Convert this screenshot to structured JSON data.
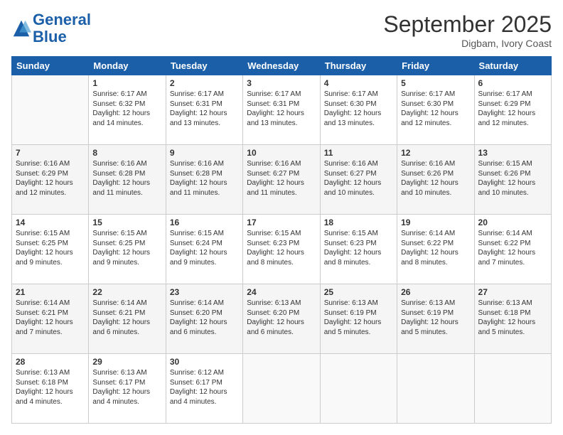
{
  "header": {
    "logo_line1": "General",
    "logo_line2": "Blue",
    "month": "September 2025",
    "location": "Digbam, Ivory Coast"
  },
  "weekdays": [
    "Sunday",
    "Monday",
    "Tuesday",
    "Wednesday",
    "Thursday",
    "Friday",
    "Saturday"
  ],
  "weeks": [
    [
      {
        "day": "",
        "info": ""
      },
      {
        "day": "1",
        "info": "Sunrise: 6:17 AM\nSunset: 6:32 PM\nDaylight: 12 hours\nand 14 minutes."
      },
      {
        "day": "2",
        "info": "Sunrise: 6:17 AM\nSunset: 6:31 PM\nDaylight: 12 hours\nand 13 minutes."
      },
      {
        "day": "3",
        "info": "Sunrise: 6:17 AM\nSunset: 6:31 PM\nDaylight: 12 hours\nand 13 minutes."
      },
      {
        "day": "4",
        "info": "Sunrise: 6:17 AM\nSunset: 6:30 PM\nDaylight: 12 hours\nand 13 minutes."
      },
      {
        "day": "5",
        "info": "Sunrise: 6:17 AM\nSunset: 6:30 PM\nDaylight: 12 hours\nand 12 minutes."
      },
      {
        "day": "6",
        "info": "Sunrise: 6:17 AM\nSunset: 6:29 PM\nDaylight: 12 hours\nand 12 minutes."
      }
    ],
    [
      {
        "day": "7",
        "info": "Sunrise: 6:16 AM\nSunset: 6:29 PM\nDaylight: 12 hours\nand 12 minutes."
      },
      {
        "day": "8",
        "info": "Sunrise: 6:16 AM\nSunset: 6:28 PM\nDaylight: 12 hours\nand 11 minutes."
      },
      {
        "day": "9",
        "info": "Sunrise: 6:16 AM\nSunset: 6:28 PM\nDaylight: 12 hours\nand 11 minutes."
      },
      {
        "day": "10",
        "info": "Sunrise: 6:16 AM\nSunset: 6:27 PM\nDaylight: 12 hours\nand 11 minutes."
      },
      {
        "day": "11",
        "info": "Sunrise: 6:16 AM\nSunset: 6:27 PM\nDaylight: 12 hours\nand 10 minutes."
      },
      {
        "day": "12",
        "info": "Sunrise: 6:16 AM\nSunset: 6:26 PM\nDaylight: 12 hours\nand 10 minutes."
      },
      {
        "day": "13",
        "info": "Sunrise: 6:15 AM\nSunset: 6:26 PM\nDaylight: 12 hours\nand 10 minutes."
      }
    ],
    [
      {
        "day": "14",
        "info": "Sunrise: 6:15 AM\nSunset: 6:25 PM\nDaylight: 12 hours\nand 9 minutes."
      },
      {
        "day": "15",
        "info": "Sunrise: 6:15 AM\nSunset: 6:25 PM\nDaylight: 12 hours\nand 9 minutes."
      },
      {
        "day": "16",
        "info": "Sunrise: 6:15 AM\nSunset: 6:24 PM\nDaylight: 12 hours\nand 9 minutes."
      },
      {
        "day": "17",
        "info": "Sunrise: 6:15 AM\nSunset: 6:23 PM\nDaylight: 12 hours\nand 8 minutes."
      },
      {
        "day": "18",
        "info": "Sunrise: 6:15 AM\nSunset: 6:23 PM\nDaylight: 12 hours\nand 8 minutes."
      },
      {
        "day": "19",
        "info": "Sunrise: 6:14 AM\nSunset: 6:22 PM\nDaylight: 12 hours\nand 8 minutes."
      },
      {
        "day": "20",
        "info": "Sunrise: 6:14 AM\nSunset: 6:22 PM\nDaylight: 12 hours\nand 7 minutes."
      }
    ],
    [
      {
        "day": "21",
        "info": "Sunrise: 6:14 AM\nSunset: 6:21 PM\nDaylight: 12 hours\nand 7 minutes."
      },
      {
        "day": "22",
        "info": "Sunrise: 6:14 AM\nSunset: 6:21 PM\nDaylight: 12 hours\nand 6 minutes."
      },
      {
        "day": "23",
        "info": "Sunrise: 6:14 AM\nSunset: 6:20 PM\nDaylight: 12 hours\nand 6 minutes."
      },
      {
        "day": "24",
        "info": "Sunrise: 6:13 AM\nSunset: 6:20 PM\nDaylight: 12 hours\nand 6 minutes."
      },
      {
        "day": "25",
        "info": "Sunrise: 6:13 AM\nSunset: 6:19 PM\nDaylight: 12 hours\nand 5 minutes."
      },
      {
        "day": "26",
        "info": "Sunrise: 6:13 AM\nSunset: 6:19 PM\nDaylight: 12 hours\nand 5 minutes."
      },
      {
        "day": "27",
        "info": "Sunrise: 6:13 AM\nSunset: 6:18 PM\nDaylight: 12 hours\nand 5 minutes."
      }
    ],
    [
      {
        "day": "28",
        "info": "Sunrise: 6:13 AM\nSunset: 6:18 PM\nDaylight: 12 hours\nand 4 minutes."
      },
      {
        "day": "29",
        "info": "Sunrise: 6:13 AM\nSunset: 6:17 PM\nDaylight: 12 hours\nand 4 minutes."
      },
      {
        "day": "30",
        "info": "Sunrise: 6:12 AM\nSunset: 6:17 PM\nDaylight: 12 hours\nand 4 minutes."
      },
      {
        "day": "",
        "info": ""
      },
      {
        "day": "",
        "info": ""
      },
      {
        "day": "",
        "info": ""
      },
      {
        "day": "",
        "info": ""
      }
    ]
  ]
}
